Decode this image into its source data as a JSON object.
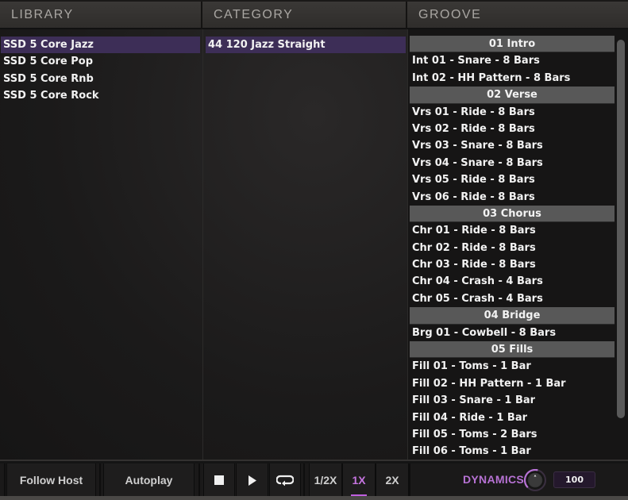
{
  "columns": {
    "library": "LIBRARY",
    "category": "CATEGORY",
    "groove": "GROOVE"
  },
  "library": {
    "items": [
      {
        "label": "SSD 5 Core Jazz",
        "selected": true
      },
      {
        "label": "SSD 5 Core Pop",
        "selected": false
      },
      {
        "label": "SSD 5 Core Rnb",
        "selected": false
      },
      {
        "label": "SSD 5 Core Rock",
        "selected": false
      }
    ]
  },
  "category": {
    "items": [
      {
        "label": "44 120 Jazz Straight",
        "selected": true
      }
    ]
  },
  "groove": {
    "sections": [
      {
        "title": "01 Intro",
        "items": [
          "Int 01 - Snare - 8 Bars",
          "Int 02 - HH Pattern - 8 Bars"
        ]
      },
      {
        "title": "02 Verse",
        "items": [
          "Vrs 01 - Ride - 8 Bars",
          "Vrs 02 - Ride - 8 Bars",
          "Vrs 03 - Snare - 8 Bars",
          "Vrs 04 - Snare - 8 Bars",
          "Vrs 05 - Ride - 8 Bars",
          "Vrs 06 - Ride - 8 Bars"
        ]
      },
      {
        "title": "03 Chorus",
        "items": [
          "Chr 01 - Ride - 8 Bars",
          "Chr 02 - Ride - 8 Bars",
          "Chr 03 - Ride - 8 Bars",
          "Chr 04 - Crash - 4 Bars",
          "Chr 05 - Crash - 4 Bars"
        ]
      },
      {
        "title": "04 Bridge",
        "items": [
          "Brg 01 - Cowbell - 8 Bars"
        ]
      },
      {
        "title": "05 Fills",
        "items": [
          "Fill 01 - Toms - 1 Bar",
          "Fill 02 - HH Pattern - 1 Bar",
          "Fill 03 - Snare - 1 Bar",
          "Fill 04 - Ride - 1 Bar",
          "Fill 05 - Toms - 2 Bars",
          "Fill 06 - Toms - 1 Bar"
        ]
      }
    ]
  },
  "footer": {
    "follow_host": "Follow Host",
    "autoplay": "Autoplay",
    "transport": {
      "stop": "stop-icon",
      "play": "play-icon",
      "loop": "loop-icon"
    },
    "speeds": [
      {
        "label": "1/2X",
        "active": false
      },
      {
        "label": "1X",
        "active": true
      },
      {
        "label": "2X",
        "active": false
      }
    ],
    "dynamics_label": "DYNAMICS",
    "dynamics_value": "100",
    "dynamics_fraction": 1.0
  },
  "colors": {
    "accent": "#c675e0",
    "selection": "#3d2e57",
    "section_header": "#585858"
  }
}
